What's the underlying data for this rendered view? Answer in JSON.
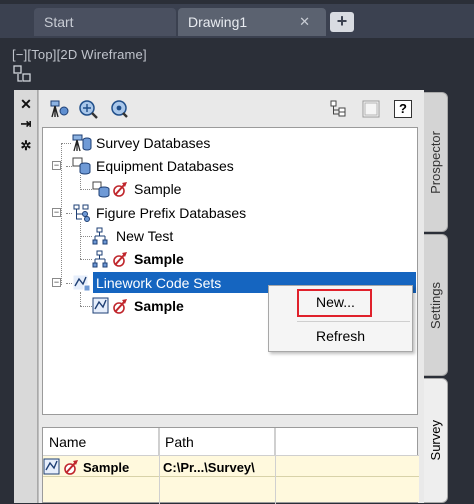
{
  "file_tabs": {
    "tabs": [
      {
        "label": "Start"
      },
      {
        "label": "Drawing1",
        "close_glyph": "✕"
      }
    ],
    "add_glyph": "+"
  },
  "viewport": {
    "label": "[−][Top][2D Wireframe]"
  },
  "palette_controls": {
    "close_glyph": "✕",
    "autohide_glyph": "⇥",
    "properties_glyph": "✲"
  },
  "toolbar": {
    "left_icons": [
      "survey-settings-icon",
      "zoom-to-point-icon",
      "pan-to-point-icon"
    ],
    "right_icons": [
      "prospector-view-icon",
      "panel-toggle-icon",
      "help-icon"
    ],
    "help_label": "?"
  },
  "tree": {
    "items": [
      {
        "label": "Survey Databases",
        "icon": "survey-database-icon",
        "bold": false
      },
      {
        "label": "Equipment Databases",
        "icon": "equipment-database-icon",
        "bold": false,
        "expander": "−"
      },
      {
        "label": "Sample",
        "icon": "equipment-database-item-icon",
        "bold": false
      },
      {
        "label": "Figure Prefix Databases",
        "icon": "figure-prefix-database-icon",
        "bold": false,
        "expander": "−"
      },
      {
        "label": "New Test",
        "icon": "figure-prefix-item-icon",
        "bold": false
      },
      {
        "label": "Sample",
        "icon": "figure-prefix-item-icon",
        "bold": true
      },
      {
        "label": "Linework Code Sets",
        "icon": "linework-code-set-icon",
        "bold": false,
        "expander": "−",
        "selected": true
      },
      {
        "label": "Sample",
        "icon": "linework-code-set-item-icon",
        "bold": true
      }
    ]
  },
  "context_menu": {
    "items": [
      {
        "label": "New...",
        "highlighted": true
      },
      {
        "label": "Refresh"
      }
    ]
  },
  "grid": {
    "columns": [
      "Name",
      "Path"
    ],
    "rows": [
      {
        "name": "Sample",
        "path": "C:\\Pr...\\Survey\\"
      }
    ]
  },
  "side_tabs": [
    {
      "label": "Prospector"
    },
    {
      "label": "Settings"
    },
    {
      "label": "Survey",
      "active": true
    }
  ],
  "colors": {
    "selection": "#1565c0",
    "highlight_box": "#e0212b",
    "grid_row": "#fff9dd",
    "app_background": "#2b2f38"
  }
}
